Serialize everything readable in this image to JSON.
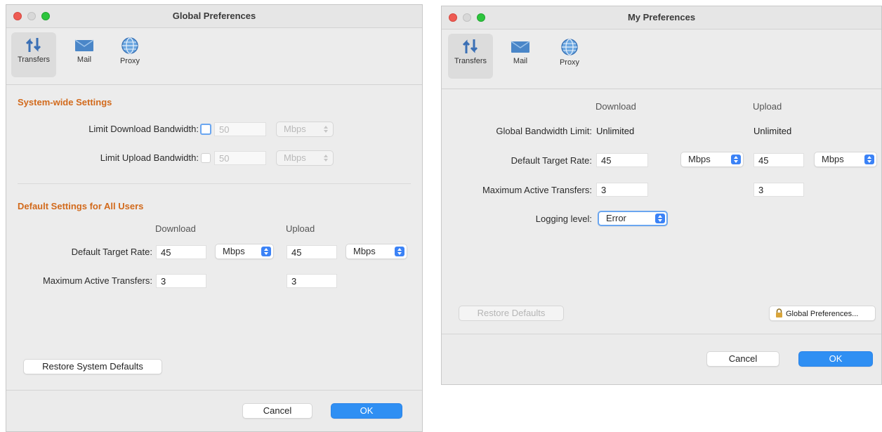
{
  "winA": {
    "title": "Global Preferences",
    "toolbar": [
      {
        "label": "Transfers",
        "icon": "transfers-icon",
        "selected": true
      },
      {
        "label": "Mail",
        "icon": "mail-icon"
      },
      {
        "label": "Proxy",
        "icon": "proxy-icon"
      }
    ],
    "system": {
      "heading": "System-wide Settings",
      "download_label": "Limit Download Bandwidth:",
      "download_value": "50",
      "download_unit": "Mbps",
      "upload_label": "Limit Upload Bandwidth:",
      "upload_value": "50",
      "upload_unit": "Mbps"
    },
    "defaults": {
      "heading": "Default Settings for All Users",
      "col_download": "Download",
      "col_upload": "Upload",
      "rate_label": "Default Target Rate:",
      "rate_download": "45",
      "rate_download_unit": "Mbps",
      "rate_upload": "45",
      "rate_upload_unit": "Mbps",
      "max_label": "Maximum Active Transfers:",
      "max_download": "3",
      "max_upload": "3"
    },
    "restore_label": "Restore System Defaults",
    "cancel_label": "Cancel",
    "ok_label": "OK"
  },
  "winB": {
    "title": "My Preferences",
    "toolbar": [
      {
        "label": "Transfers",
        "icon": "transfers-icon",
        "selected": true
      },
      {
        "label": "Mail",
        "icon": "mail-icon"
      },
      {
        "label": "Proxy",
        "icon": "proxy-icon"
      }
    ],
    "col_download": "Download",
    "col_upload": "Upload",
    "global_label": "Global Bandwidth Limit:",
    "global_download": "Unlimited",
    "global_upload": "Unlimited",
    "rate_label": "Default Target Rate:",
    "rate_download": "45",
    "rate_download_unit": "Mbps",
    "rate_upload": "45",
    "rate_upload_unit": "Mbps",
    "max_label": "Maximum Active Transfers:",
    "max_download": "3",
    "max_upload": "3",
    "logging_label": "Logging level:",
    "logging_value": "Error",
    "restore_label": "Restore Defaults",
    "global_prefs_label": "Global Preferences...",
    "cancel_label": "Cancel",
    "ok_label": "OK"
  },
  "colors": {
    "accent": "#2f8ff3",
    "section_heading": "#d26a1c",
    "close": "#ee5b53",
    "zoom": "#2dc53d"
  }
}
